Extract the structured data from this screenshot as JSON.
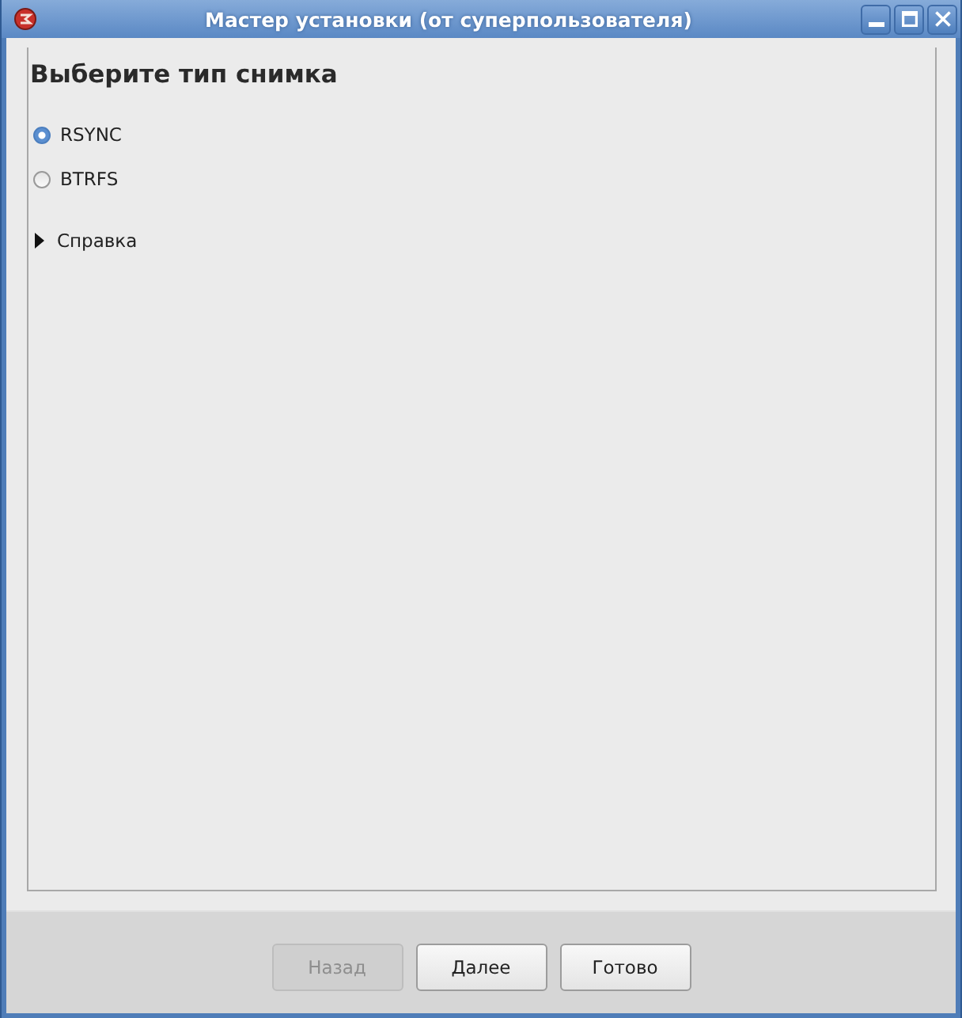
{
  "window": {
    "title": "Мастер установки (от суперпользователя)"
  },
  "heading": "Выберите тип снимка",
  "options": [
    {
      "label": "RSYNC",
      "selected": true
    },
    {
      "label": "BTRFS",
      "selected": false
    }
  ],
  "expander": {
    "label": "Справка",
    "expanded": false
  },
  "buttons": [
    {
      "label": "Назад",
      "disabled": true
    },
    {
      "label": "Далее",
      "disabled": false
    },
    {
      "label": "Готово",
      "disabled": false
    }
  ]
}
